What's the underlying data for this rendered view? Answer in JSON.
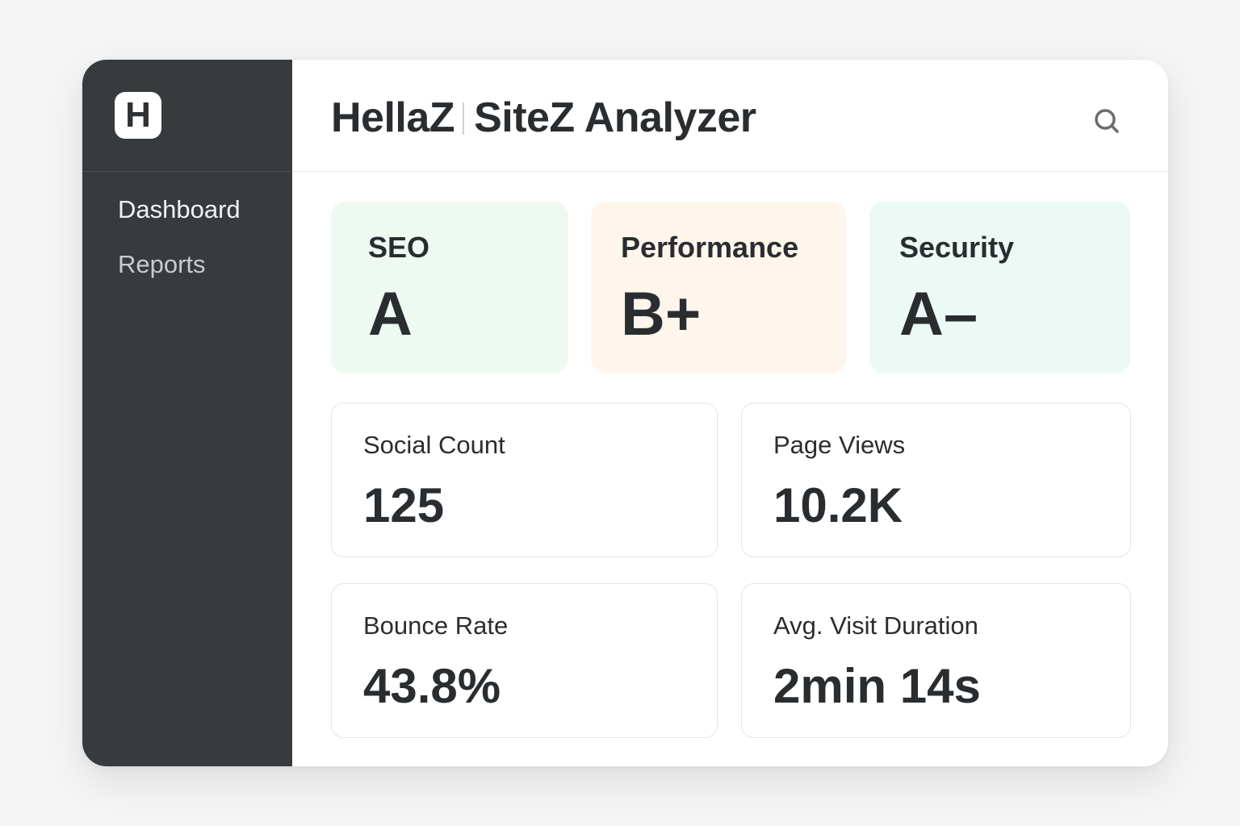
{
  "sidebar": {
    "logo_letter": "H",
    "items": [
      {
        "label": "Dashboard"
      },
      {
        "label": "Reports"
      }
    ]
  },
  "header": {
    "title_part1": "HellaZ",
    "title_part2": "SiteZ Analyzer",
    "search_icon": "search-icon"
  },
  "grades": [
    {
      "label": "SEO",
      "value": "A",
      "color": "#eefaf1"
    },
    {
      "label": "Performance",
      "value": "B+",
      "color": "#fef6ec"
    },
    {
      "label": "Security",
      "value": "A–",
      "color": "#ecf9f4"
    }
  ],
  "stats": [
    {
      "label": "Social Count",
      "value": "125"
    },
    {
      "label": "Page Views",
      "value": "10.2K"
    },
    {
      "label": "Bounce Rate",
      "value": "43.8%"
    },
    {
      "label": "Avg. Visit Duration",
      "value": "2min 14s"
    }
  ]
}
